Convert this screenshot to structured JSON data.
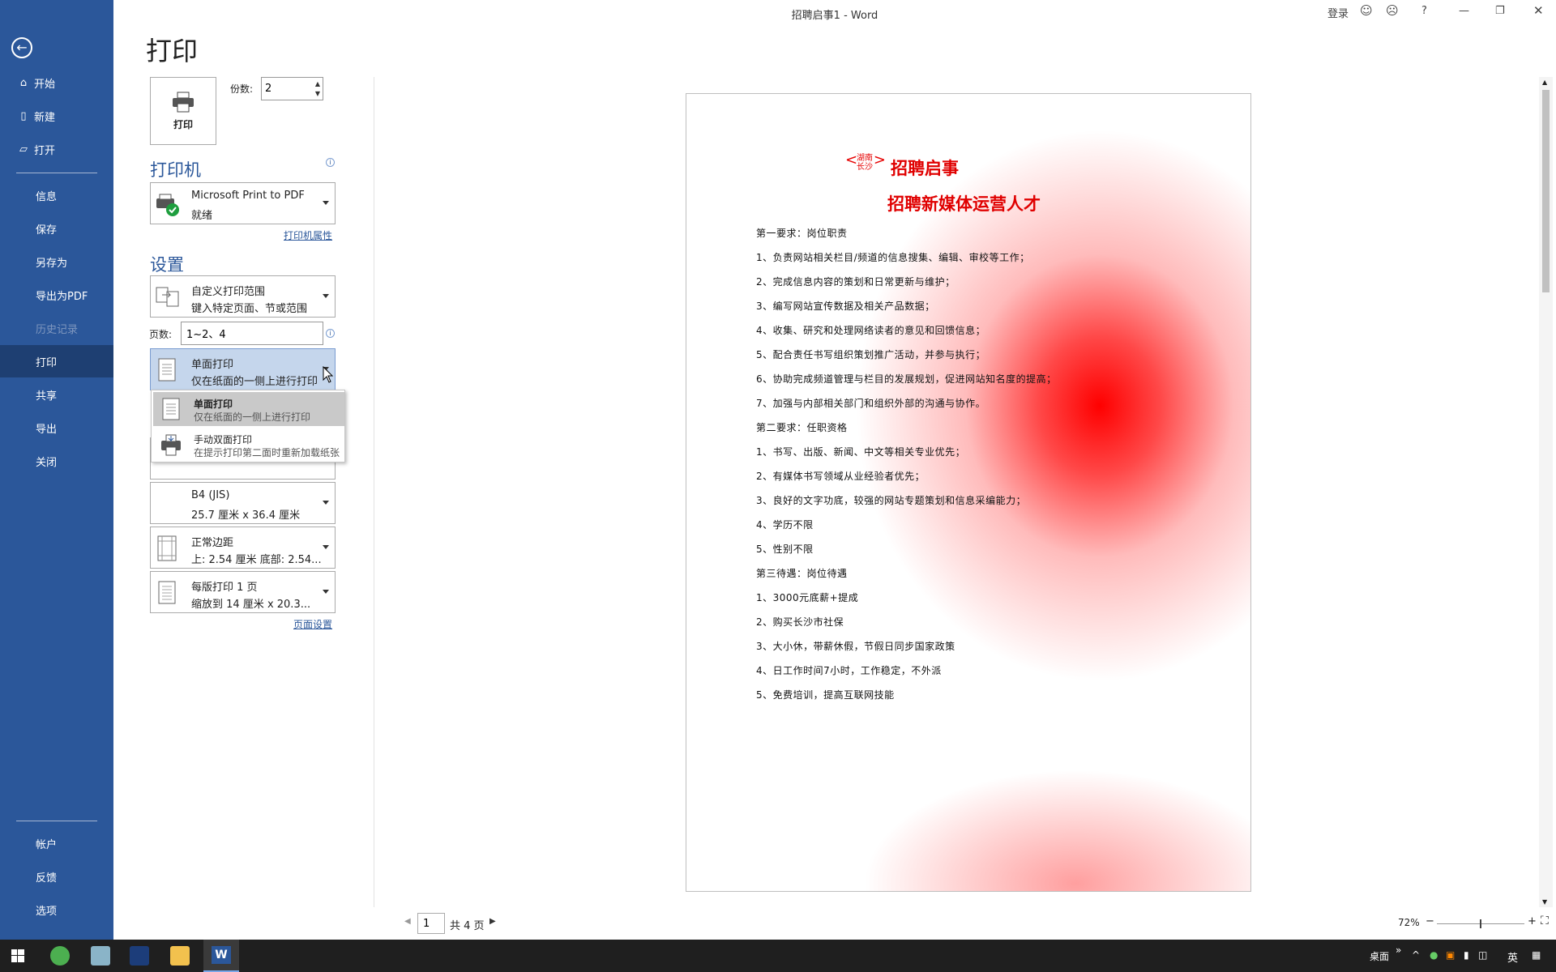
{
  "window": {
    "title": "招聘启事1  -  Word",
    "login": "登录",
    "help": "?",
    "smile_icon": "smile-icon",
    "frown_icon": "frown-icon"
  },
  "sidebar": {
    "items": [
      {
        "label": "开始",
        "icon": "home-icon"
      },
      {
        "label": "新建",
        "icon": "new-doc-icon"
      },
      {
        "label": "打开",
        "icon": "folder-open-icon"
      },
      {
        "label": "信息"
      },
      {
        "label": "保存"
      },
      {
        "label": "另存为"
      },
      {
        "label": "导出为PDF"
      },
      {
        "label": "历史记录",
        "disabled": true
      },
      {
        "label": "打印",
        "active": true
      },
      {
        "label": "共享"
      },
      {
        "label": "导出"
      },
      {
        "label": "关闭"
      }
    ],
    "bottom": [
      {
        "label": "帐户"
      },
      {
        "label": "反馈"
      },
      {
        "label": "选项"
      }
    ]
  },
  "print": {
    "heading": "打印",
    "print_button": "打印",
    "copies_label": "份数:",
    "copies_value": "2",
    "printer_section": "打印机",
    "printer_name": "Microsoft Print to PDF",
    "printer_status": "就绪",
    "printer_properties": "打印机属性",
    "settings_section": "设置",
    "range_title": "自定义打印范围",
    "range_sub": "键入特定页面、节或范围",
    "pages_label": "页数:",
    "pages_value": "1~2、4",
    "duplex_title": "单面打印",
    "duplex_sub": "仅在纸面的一侧上进行打印",
    "menu": [
      {
        "title": "单面打印",
        "sub": "仅在纸面的一侧上进行打印",
        "selected": true
      },
      {
        "title": "手动双面打印",
        "sub": "在提示打印第二面时重新加载纸张"
      }
    ],
    "paper_title": "B4 (JIS)",
    "paper_sub": "25.7 厘米 x 36.4 厘米",
    "margin_title": "正常边距",
    "margin_sub": "上: 2.54 厘米 底部: 2.54...",
    "pps_title": "每版打印 1 页",
    "pps_sub": "缩放到 14 厘米 x 20.3...",
    "page_setup": "页面设置"
  },
  "document": {
    "badge_top": "湖南",
    "badge_bottom": "长沙",
    "title1": "招聘启事",
    "title2": "招聘新媒体运营人才",
    "lines": [
      "第一要求：岗位职责",
      "1、负责网站相关栏目/频道的信息搜集、编辑、审校等工作；",
      "2、完成信息内容的策划和日常更新与维护；",
      "3、编写网站宣传数据及相关产品数据；",
      "4、收集、研究和处理网络读者的意见和回馈信息；",
      "5、配合责任书写组织策划推广活动，并参与执行；",
      "6、协助完成频道管理与栏目的发展规划，促进网站知名度的提高；",
      "7、加强与内部相关部门和组织外部的沟通与协作。",
      "第二要求：任职资格",
      "1、书写、出版、新闻、中文等相关专业优先；",
      "2、有媒体书写领域从业经验者优先；",
      "3、良好的文字功底，较强的网站专题策划和信息采编能力；",
      "4、学历不限",
      "5、性别不限",
      "第三待遇：岗位待遇",
      "1、3000元底薪+提成",
      "2、购买长沙市社保",
      "3、大小休，带薪休假，节假日同步国家政策",
      "4、日工作时间7小时，工作稳定，不外派",
      "5、免费培训，提高互联网技能"
    ]
  },
  "pagenav": {
    "current": "1",
    "total": "共 4 页",
    "zoom": "72%",
    "zoom_minus": "−",
    "zoom_plus": "+",
    "zoom_level": 0.5
  },
  "taskbar": {
    "desktop": "桌面",
    "ime": "英",
    "chevron": "»"
  }
}
